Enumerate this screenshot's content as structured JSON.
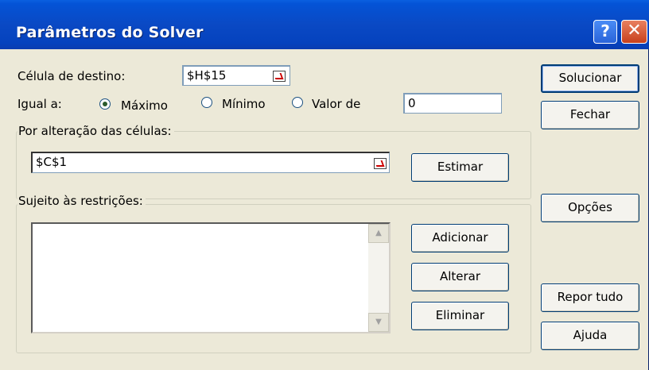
{
  "window": {
    "title": "Parâmetros do Solver",
    "help_glyph": "?",
    "close_glyph": "✕"
  },
  "target": {
    "label": "Célula de destino:",
    "value": "$H$15"
  },
  "equal": {
    "label": "Igual a:",
    "options": [
      {
        "label": "Máximo",
        "checked": true
      },
      {
        "label": "Mínimo",
        "checked": false
      },
      {
        "label": "Valor de",
        "checked": false
      }
    ],
    "value": "0"
  },
  "changing": {
    "legend": "Por alteração das células:",
    "value": "$C$1",
    "guess_label": "Estimar"
  },
  "constraints": {
    "legend": "Sujeito às restrições:",
    "items": []
  },
  "buttons": {
    "solve": "Solucionar",
    "close": "Fechar",
    "options": "Opções",
    "add": "Adicionar",
    "change": "Alterar",
    "delete": "Eliminar",
    "reset": "Repor tudo",
    "help": "Ajuda"
  },
  "icons": {
    "scroll_up": "▲",
    "scroll_down": "▼"
  },
  "colors": {
    "titlebar": "#0A49C4",
    "face": "#ECE9D8"
  }
}
